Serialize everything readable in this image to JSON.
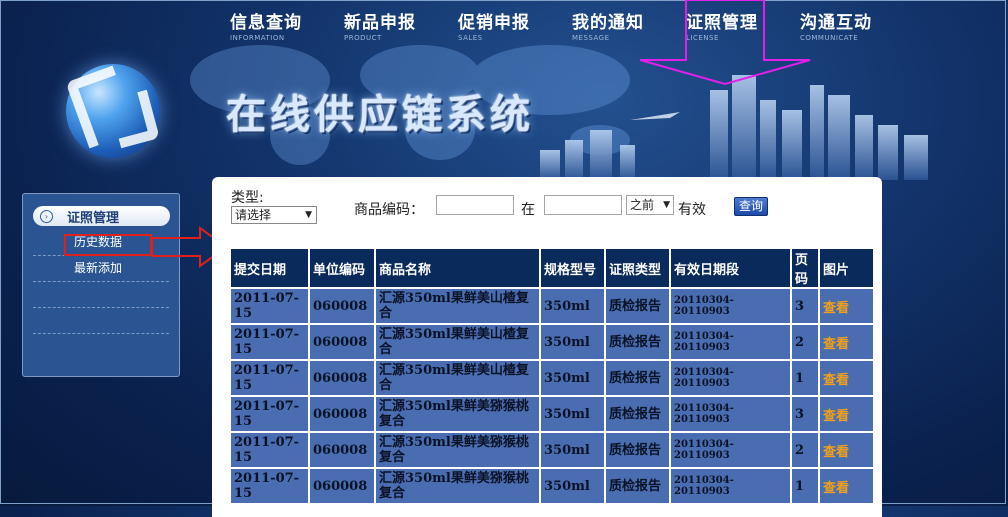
{
  "nav": [
    {
      "cn": "信息查询",
      "en": "INFORMATION"
    },
    {
      "cn": "新品申报",
      "en": "PRODUCT"
    },
    {
      "cn": "促销申报",
      "en": "SALES"
    },
    {
      "cn": "我的通知",
      "en": "MESSAGE"
    },
    {
      "cn": "证照管理",
      "en": "LICENSE"
    },
    {
      "cn": "沟通互动",
      "en": "COMMUNICATE"
    }
  ],
  "site_title": "在线供应链系统",
  "sidebar": {
    "title": "证照管理",
    "items": [
      {
        "label": "历史数据"
      },
      {
        "label": "最新添加"
      },
      {
        "label": ""
      },
      {
        "label": ""
      }
    ]
  },
  "filters": {
    "type_label": "类型:",
    "type_value": "请选择",
    "code_label": "商品编码：",
    "in_label": "在",
    "when_value": "之前",
    "valid_label": "有效",
    "query_button": "查询"
  },
  "table": {
    "headers": [
      "提交日期",
      "单位编码",
      "商品名称",
      "规格型号",
      "证照类型",
      "有效日期段",
      "页码",
      "图片"
    ],
    "rows": [
      [
        "2011-07-15",
        "060008",
        "汇源350ml果鲜美山楂复合",
        "350ml",
        "质检报告",
        "20110304-20110903",
        "3",
        "查看"
      ],
      [
        "2011-07-15",
        "060008",
        "汇源350ml果鲜美山楂复合",
        "350ml",
        "质检报告",
        "20110304-20110903",
        "2",
        "查看"
      ],
      [
        "2011-07-15",
        "060008",
        "汇源350ml果鲜美山楂复合",
        "350ml",
        "质检报告",
        "20110304-20110903",
        "1",
        "查看"
      ],
      [
        "2011-07-15",
        "060008",
        "汇源350ml果鲜美猕猴桃复合",
        "350ml",
        "质检报告",
        "20110304-20110903",
        "3",
        "查看"
      ],
      [
        "2011-07-15",
        "060008",
        "汇源350ml果鲜美猕猴桃复合",
        "350ml",
        "质检报告",
        "20110304-20110903",
        "2",
        "查看"
      ],
      [
        "2011-07-15",
        "060008",
        "汇源350ml果鲜美猕猴桃复合",
        "350ml",
        "质检报告",
        "20110304-20110903",
        "1",
        "查看"
      ]
    ]
  },
  "colors": {
    "annotation_magenta": "#e020e8",
    "annotation_red": "#e0201c",
    "link_orange": "#f1a019",
    "header_navy": "#0b2a5c",
    "cell_blue": "#4a6db1"
  }
}
